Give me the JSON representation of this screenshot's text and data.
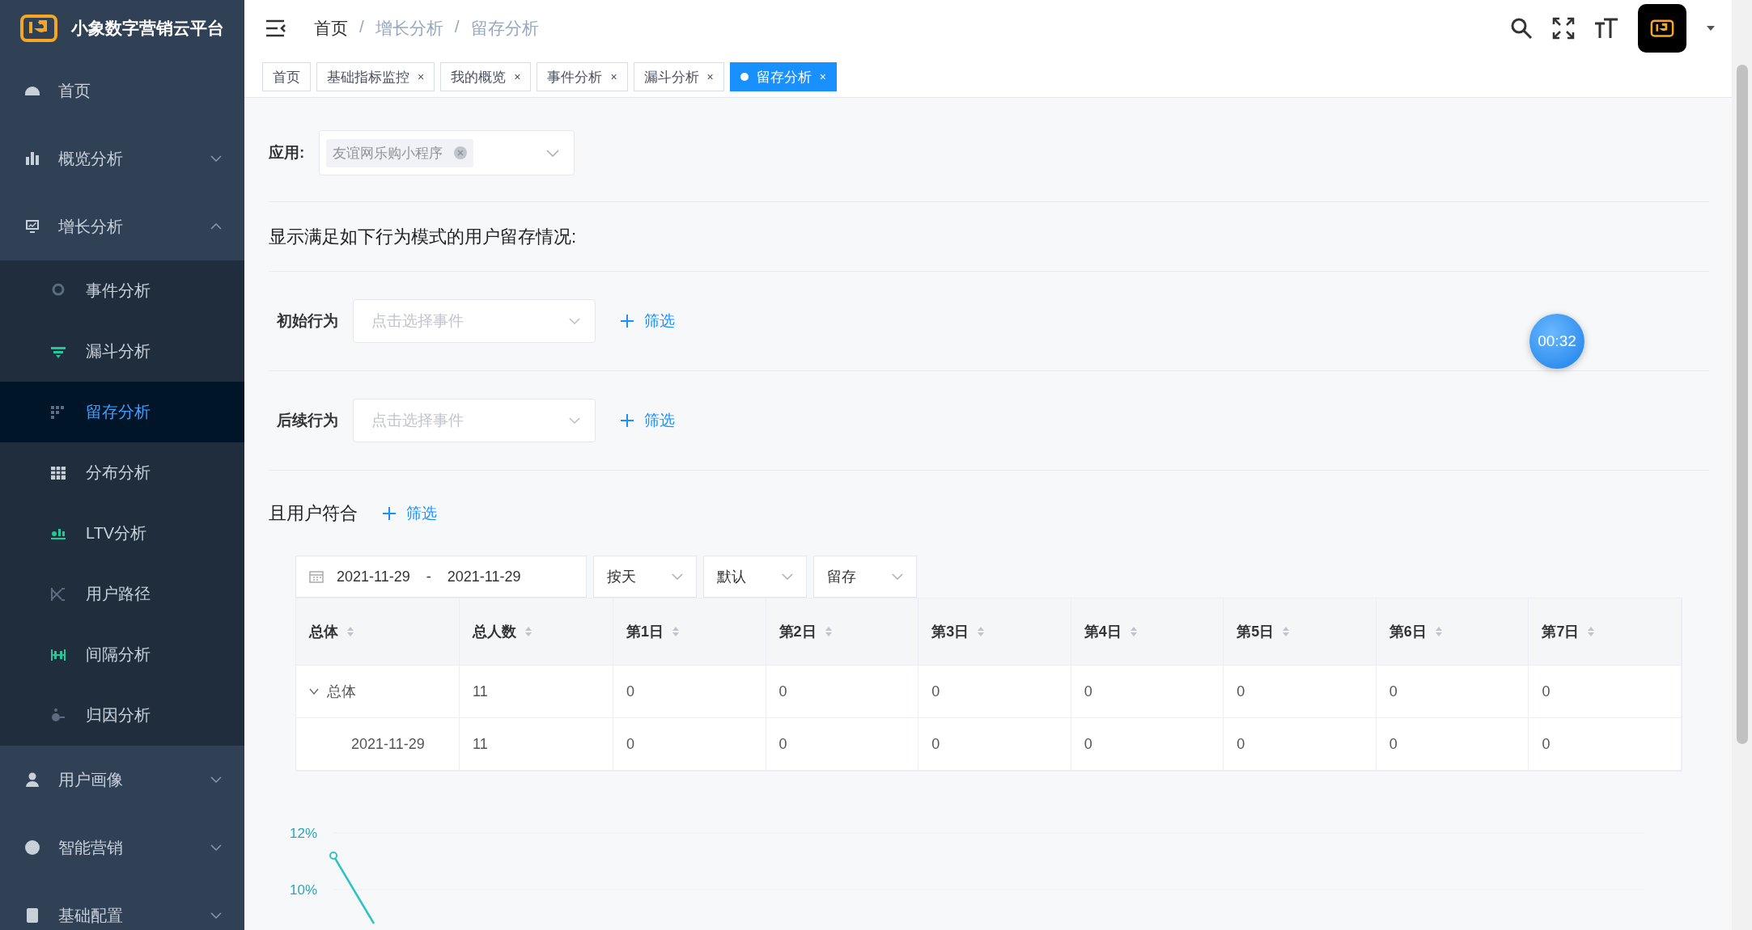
{
  "logo": {
    "title": "小象数字营销云平台"
  },
  "sidebar": {
    "items": [
      {
        "label": "首页"
      },
      {
        "label": "概览分析",
        "expanded": false
      },
      {
        "label": "增长分析",
        "expanded": true,
        "children": [
          {
            "label": "事件分析",
            "selected": false
          },
          {
            "label": "漏斗分析",
            "selected": false
          },
          {
            "label": "留存分析",
            "selected": true
          },
          {
            "label": "分布分析",
            "selected": false
          },
          {
            "label": "LTV分析",
            "selected": false
          },
          {
            "label": "用户路径",
            "selected": false
          },
          {
            "label": "间隔分析",
            "selected": false
          },
          {
            "label": "归因分析",
            "selected": false
          }
        ]
      },
      {
        "label": "用户画像",
        "expanded": false
      },
      {
        "label": "智能营销",
        "expanded": false
      },
      {
        "label": "基础配置",
        "expanded": false
      }
    ]
  },
  "breadcrumb": {
    "separator": "/",
    "items": [
      "首页",
      "增长分析",
      "留存分析"
    ]
  },
  "tabs": [
    {
      "label": "首页",
      "selected": false
    },
    {
      "label": "基础指标监控",
      "selected": false,
      "close": "×"
    },
    {
      "label": "我的概览",
      "selected": false,
      "close": "×"
    },
    {
      "label": "事件分析",
      "selected": false,
      "close": "×"
    },
    {
      "label": "漏斗分析",
      "selected": false,
      "close": "×"
    },
    {
      "label": "留存分析",
      "selected": true,
      "close": "×"
    }
  ],
  "app_field": {
    "label": "应用:",
    "tag": "友谊网乐购小程序"
  },
  "heading": "显示满足如下行为模式的用户留存情况:",
  "behaviors": [
    {
      "label": "初始行为",
      "placeholder": "点击选择事件",
      "filter": "筛选"
    },
    {
      "label": "后续行为",
      "placeholder": "点击选择事件",
      "filter": "筛选"
    }
  ],
  "user_filter": {
    "label": "且用户符合",
    "filter": "筛选"
  },
  "date_range": {
    "start": "2021-11-29",
    "separator": "-",
    "end": "2021-11-29"
  },
  "selects": [
    "按天",
    "默认",
    "留存"
  ],
  "table": {
    "columns": [
      "总体",
      "总人数",
      "第1日",
      "第2日",
      "第3日",
      "第4日",
      "第5日",
      "第6日",
      "第7日"
    ],
    "rows": [
      {
        "cells": [
          "总体",
          "11",
          "0",
          "0",
          "0",
          "0",
          "0",
          "0",
          "0"
        ],
        "expanded": true,
        "children": [
          {
            "cells": [
              "2021-11-29",
              "11",
              "0",
              "0",
              "0",
              "0",
              "0",
              "0",
              "0"
            ]
          }
        ]
      }
    ]
  },
  "timer": "00:32",
  "chart": {
    "axis_labels": [
      "12%",
      "10%"
    ]
  }
}
